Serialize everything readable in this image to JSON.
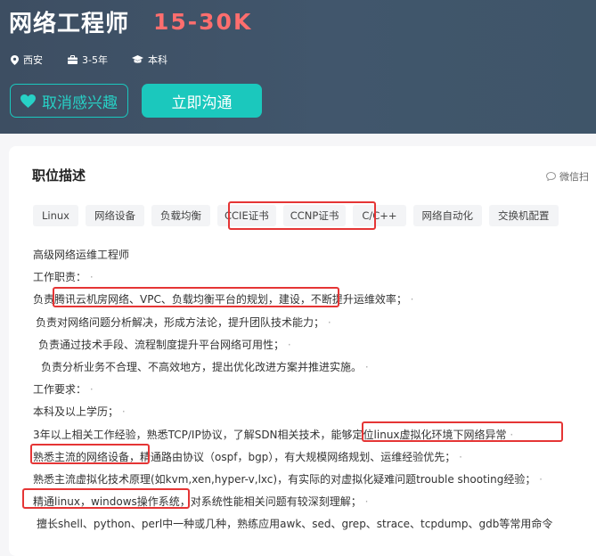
{
  "job": {
    "title": "网络工程师",
    "salary": "15-30K",
    "city": "西安",
    "experience": "3-5年",
    "education": "本科"
  },
  "actions": {
    "uninterest_label": "取消感兴趣",
    "chat_label": "立即沟通"
  },
  "section": {
    "title": "职位描述",
    "wechat_label": "微信扫"
  },
  "tags": [
    "Linux",
    "网络设备",
    "负载均衡",
    "CCIE证书",
    "CCNP证书",
    "C/C++",
    "网络自动化",
    "交换机配置"
  ],
  "description": {
    "line0": "高级网络运维工程师",
    "line1": "工作职责：",
    "line2_pre": "负责",
    "line2_hl": "腾讯云机房网络、VPC、负载均衡平台的规划，建设",
    "line2_post": "，不断提升运维效率；",
    "line3": "负责对网络问题分析解决，形成方法论，提升团队技术能力；",
    "line4": "负责通过技术手段、流程制度提升平台网络可用性；",
    "line5": "负责分析业务不合理、不高效地方，提出优化改进方案并推进实施。",
    "line6": "工作要求：",
    "line7": "本科及以上学历；",
    "line8_pre": "3年以上相关工作经验，熟悉TCP/IP协议，了解SDN相关技术，",
    "line8_hl": "能够定位linux虚拟化环境下网络异常",
    "line9_hl": "熟悉主流的网络设备",
    "line9_post": "，精通路由协议（ospf，bgp），有大规模网络规划、运维经验优先；",
    "line10": "熟悉主流虚拟化技术原理(如kvm,xen,hyper-v,lxc)，有实际的对虚拟化疑难问题trouble shooting经验；",
    "line11_hl": "精通linux，windows操作系统",
    "line11_post": "，对系统性能相关问题有较深刻理解；",
    "line12": "擅长shell、python、perl中一种或几种，熟练应用awk、sed、grep、strace、tcpdump、gdb等常用命令"
  },
  "colors": {
    "header_bg": "#3f5368",
    "salary": "#ff6e6e",
    "accent": "#1bc8bd",
    "highlight_border": "#e53535"
  }
}
